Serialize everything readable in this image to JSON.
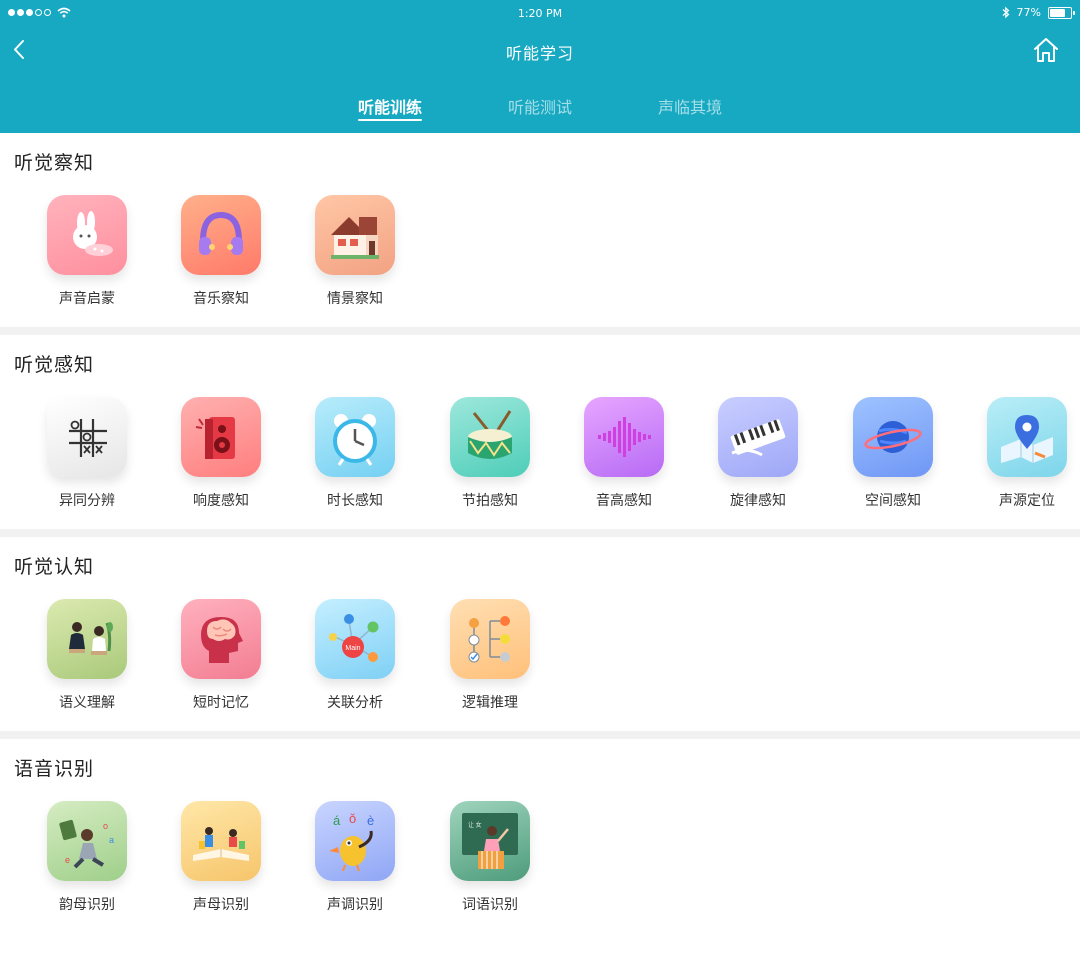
{
  "status_bar": {
    "time": "1:20 PM",
    "battery": "77%",
    "battery_level": 0.77
  },
  "header": {
    "title": "听能学习"
  },
  "tabs": [
    {
      "label": "听能训练",
      "active": true
    },
    {
      "label": "听能测试",
      "active": false
    },
    {
      "label": "声临其境",
      "active": false
    }
  ],
  "sections": [
    {
      "title": "听觉察知",
      "items": [
        {
          "label": "声音启蒙",
          "icon": "bunny-icon",
          "colors": [
            "#ffb3bd",
            "#ff8f9e"
          ]
        },
        {
          "label": "音乐察知",
          "icon": "headphones-icon",
          "colors": [
            "#ffb08a",
            "#ff7a6a"
          ]
        },
        {
          "label": "情景察知",
          "icon": "house-icon",
          "colors": [
            "#ffc7a6",
            "#f2a283"
          ]
        }
      ]
    },
    {
      "title": "听觉感知",
      "items": [
        {
          "label": "异同分辨",
          "icon": "tic-tac-toe-icon",
          "colors": [
            "#ffffff",
            "#e6e6e6"
          ]
        },
        {
          "label": "响度感知",
          "icon": "speaker-icon",
          "colors": [
            "#ffb0b0",
            "#ff7e7e"
          ]
        },
        {
          "label": "时长感知",
          "icon": "alarm-clock-icon",
          "colors": [
            "#b8ecfb",
            "#75d0f2"
          ]
        },
        {
          "label": "节拍感知",
          "icon": "drum-icon",
          "colors": [
            "#9de8dc",
            "#4ecdb8"
          ]
        },
        {
          "label": "音高感知",
          "icon": "sound-wave-icon",
          "colors": [
            "#e7a6ff",
            "#b76bf5"
          ]
        },
        {
          "label": "旋律感知",
          "icon": "piano-keyboard-icon",
          "colors": [
            "#c9ceff",
            "#9ea7f7"
          ]
        },
        {
          "label": "空间感知",
          "icon": "planet-icon",
          "colors": [
            "#9fc3ff",
            "#6f97f5"
          ]
        },
        {
          "label": "声源定位",
          "icon": "location-map-icon",
          "colors": [
            "#b9eef7",
            "#7dd5ea"
          ]
        }
      ]
    },
    {
      "title": "听觉认知",
      "items": [
        {
          "label": "语义理解",
          "icon": "conversation-people-icon",
          "colors": [
            "#dceab0",
            "#a9c97a"
          ]
        },
        {
          "label": "短时记忆",
          "icon": "head-brain-icon",
          "colors": [
            "#ffb1be",
            "#f37d92"
          ]
        },
        {
          "label": "关联分析",
          "icon": "mind-map-icon",
          "colors": [
            "#c5efff",
            "#7fd0f5"
          ]
        },
        {
          "label": "逻辑推理",
          "icon": "logic-tree-icon",
          "colors": [
            "#ffdfb3",
            "#ffc07a"
          ]
        }
      ]
    },
    {
      "title": "语音识别",
      "items": [
        {
          "label": "韵母识别",
          "icon": "reading-girl-icon",
          "colors": [
            "#d5ecc2",
            "#9fcf8a"
          ]
        },
        {
          "label": "声母识别",
          "icon": "pop-up-book-icon",
          "colors": [
            "#ffe7a8",
            "#f6c56b"
          ]
        },
        {
          "label": "声调识别",
          "icon": "bird-tones-icon",
          "colors": [
            "#c9d5ff",
            "#8fa6f5"
          ]
        },
        {
          "label": "词语识别",
          "icon": "teacher-board-icon",
          "colors": [
            "#9fd4bd",
            "#4e9c7c"
          ]
        }
      ]
    }
  ]
}
